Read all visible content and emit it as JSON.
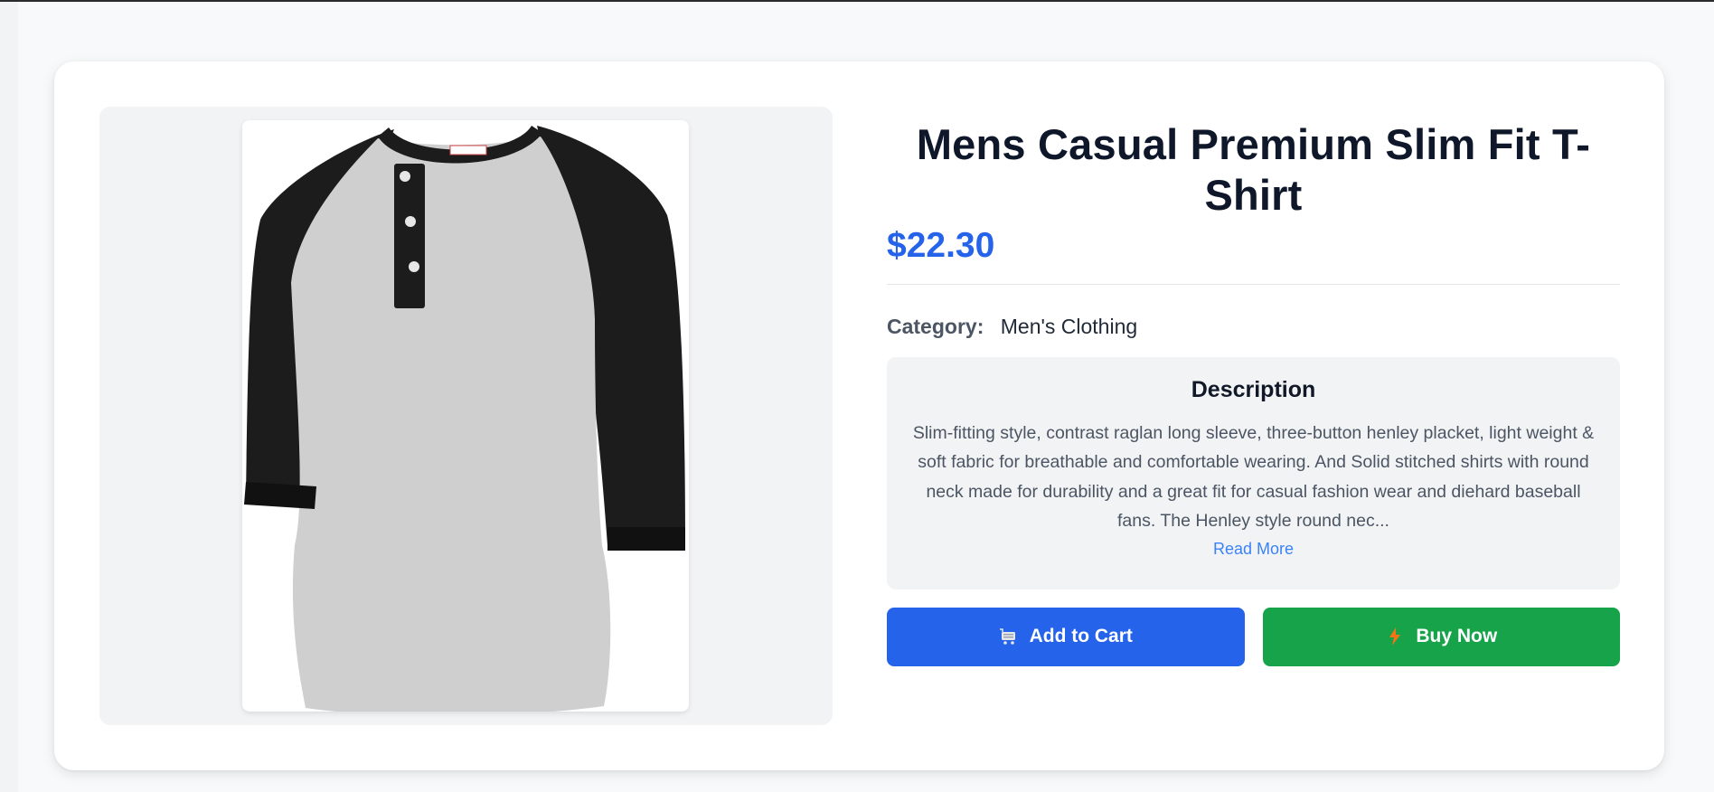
{
  "product": {
    "title": "Mens Casual Premium Slim Fit T-Shirt",
    "price": "$22.30",
    "category_label": "Category:",
    "category_value": "Men's Clothing",
    "image_alt": "Grey henley raglan shirt with black three-quarter sleeves",
    "description": {
      "heading": "Description",
      "text": "Slim-fitting style, contrast raglan long sleeve, three-button henley placket, light weight & soft fabric for breathable and comfortable wearing. And Solid stitched shirts with round neck made for durability and a great fit for casual fashion wear and diehard baseball fans. The Henley style round nec...",
      "read_more": "Read More"
    }
  },
  "actions": {
    "add_to_cart": {
      "label": "Add to Cart",
      "icon": "cart-icon"
    },
    "buy_now": {
      "label": "Buy Now",
      "icon": "lightning-icon"
    }
  },
  "colors": {
    "price": "#2563eb",
    "add_to_cart_bg": "#2563eb",
    "buy_now_bg": "#16a34a",
    "read_more": "#3b82f6",
    "title": "#0f172a"
  }
}
